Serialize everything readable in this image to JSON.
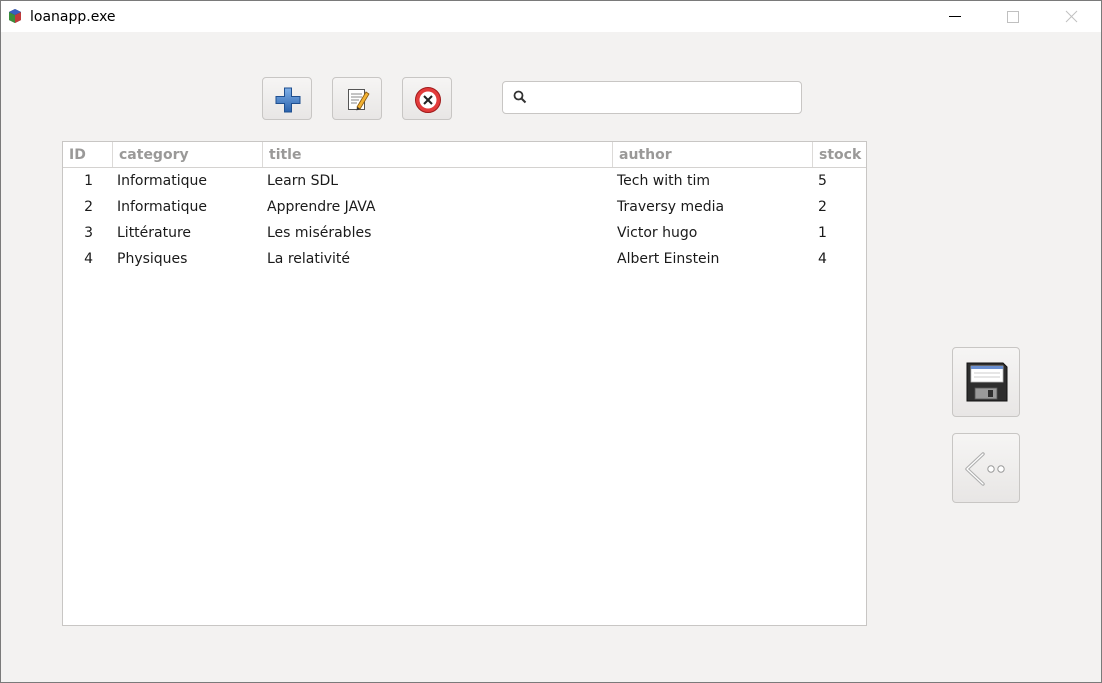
{
  "window": {
    "title": "loanapp.exe"
  },
  "toolbar": {
    "add_icon": "plus-icon",
    "edit_icon": "edit-note-icon",
    "delete_icon": "delete-circle-icon"
  },
  "search": {
    "icon": "search-icon",
    "value": "",
    "placeholder": ""
  },
  "table": {
    "columns": [
      "ID",
      "category",
      "title",
      "author",
      "stock"
    ],
    "rows": [
      [
        "1",
        "Informatique",
        "Learn SDL",
        "Tech with tim",
        "5"
      ],
      [
        "2",
        "Informatique",
        "Apprendre JAVA",
        "Traversy media",
        "2"
      ],
      [
        "3",
        "Littérature",
        "Les misérables",
        "Victor hugo",
        "1"
      ],
      [
        "4",
        "Physiques",
        "La relativité",
        "Albert Einstein",
        "4"
      ]
    ]
  },
  "side": {
    "save_icon": "floppy-disk-icon",
    "back_icon": "back-arrow-icon"
  },
  "colors": {
    "window_bg": "#f3f2f1",
    "header_text": "#9a9998",
    "plus_blue": "#3b78c4",
    "delete_red": "#d92020"
  }
}
